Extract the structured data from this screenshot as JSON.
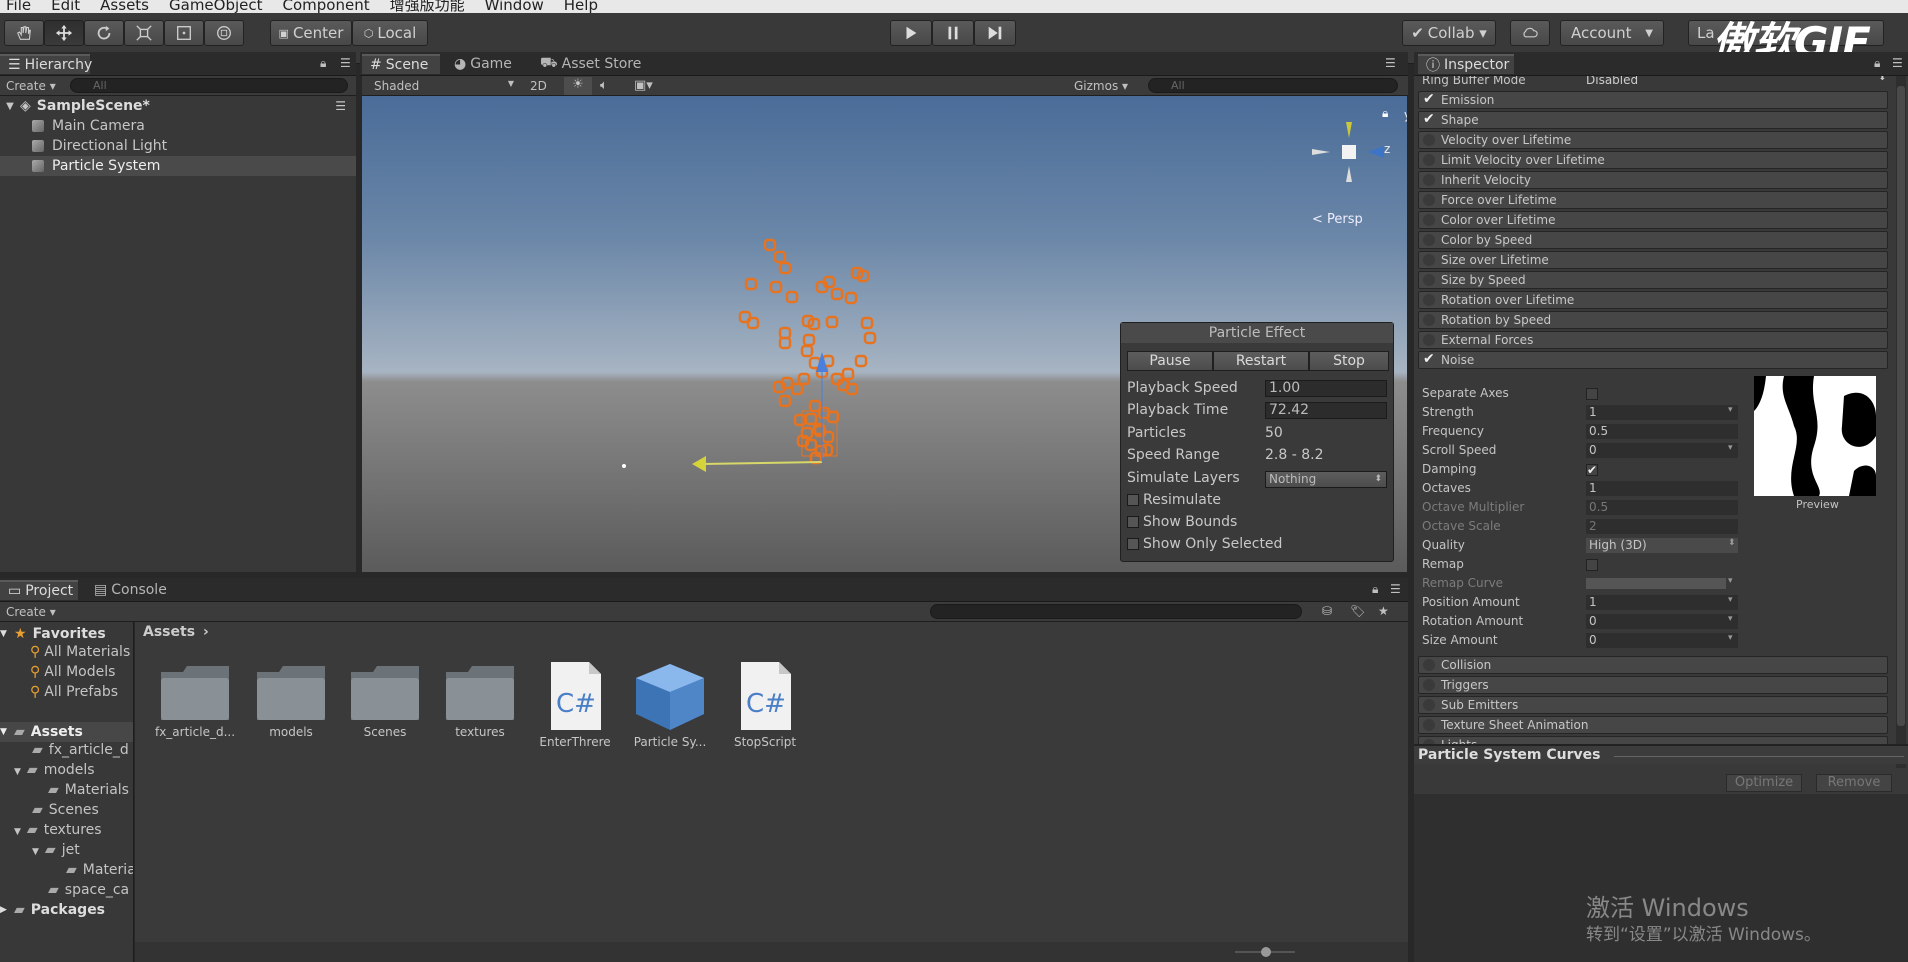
{
  "menu": [
    "File",
    "Edit",
    "Assets",
    "GameObject",
    "Component",
    "增强版功能",
    "Window",
    "Help"
  ],
  "toolbar": {
    "center": "Center",
    "local": "Local",
    "collab": "Collab ▾",
    "account": "Account",
    "layers": "La",
    "watermark": "傲软GIF"
  },
  "hierarchy": {
    "tab": "Hierarchy",
    "create": "Create ▾",
    "search_placeholder": "All",
    "scene": "SampleScene*",
    "items": [
      "Main Camera",
      "Directional Light",
      "Particle System"
    ]
  },
  "scene_tabs": {
    "scene": "Scene",
    "game": "Game",
    "asset_store": "Asset Store"
  },
  "scene_bar": {
    "shaded": "Shaded",
    "twod": "2D",
    "gizmos": "Gizmos ▾",
    "search_placeholder": "All"
  },
  "gizmo": {
    "y": "y",
    "z": "z",
    "persp": "< Persp"
  },
  "particle_effect": {
    "title": "Particle Effect",
    "pause": "Pause",
    "restart": "Restart",
    "stop": "Stop",
    "playback_speed_label": "Playback Speed",
    "playback_speed": "1.00",
    "playback_time_label": "Playback Time",
    "playback_time": "72.42",
    "particles_label": "Particles",
    "particles": "50",
    "speed_range_label": "Speed Range",
    "speed_range": "2.8 - 8.2",
    "simulate_layers_label": "Simulate Layers",
    "simulate_layers": "Nothing",
    "resimulate": "Resimulate",
    "show_bounds": "Show Bounds",
    "show_only_selected": "Show Only Selected"
  },
  "project": {
    "tab": "Project",
    "console": "Console",
    "create": "Create ▾",
    "favorites": "Favorites",
    "fav_items": [
      "All Materials",
      "All Models",
      "All Prefabs"
    ],
    "assets": "Assets",
    "tree": [
      "fx_article_d",
      "models",
      "Materials",
      "Scenes",
      "textures",
      "jet",
      "Materia",
      "space_ca"
    ],
    "packages": "Packages",
    "breadcrumb": "Assets",
    "items": [
      "fx_article_d...",
      "models",
      "Scenes",
      "textures",
      "EnterThrere",
      "Particle Sy...",
      "StopScript"
    ]
  },
  "inspector": {
    "tab": "Inspector",
    "ring_buffer_label": "Ring Buffer Mode",
    "ring_buffer": "Disabled",
    "modules": [
      "Emission",
      "Shape",
      "Velocity over Lifetime",
      "Limit Velocity over Lifetime",
      "Inherit Velocity",
      "Force over Lifetime",
      "Color over Lifetime",
      "Color by Speed",
      "Size over Lifetime",
      "Size by Speed",
      "Rotation over Lifetime",
      "Rotation by Speed",
      "External Forces",
      "Noise"
    ],
    "noise_props": [
      [
        "Separate Axes",
        ""
      ],
      [
        "Strength",
        "1"
      ],
      [
        "Frequency",
        "0.5"
      ],
      [
        "Scroll Speed",
        "0"
      ],
      [
        "Damping",
        ""
      ],
      [
        "Octaves",
        "1"
      ],
      [
        "Octave Multiplier",
        "0.5"
      ],
      [
        "Octave Scale",
        "2"
      ],
      [
        "Quality",
        "High (3D)"
      ],
      [
        "Remap",
        ""
      ],
      [
        "Remap Curve",
        ""
      ],
      [
        "Position Amount",
        "1"
      ],
      [
        "Rotation Amount",
        "0"
      ],
      [
        "Size Amount",
        "0"
      ]
    ],
    "preview": "Preview",
    "modules2": [
      "Collision",
      "Triggers",
      "Sub Emitters",
      "Texture Sheet Animation",
      "Lights"
    ],
    "curves_title": "Particle System Curves",
    "optimize": "Optimize",
    "remove": "Remove",
    "activate": "激活 Windows",
    "activate_sub": "转到“设置”以激活 Windows。"
  }
}
